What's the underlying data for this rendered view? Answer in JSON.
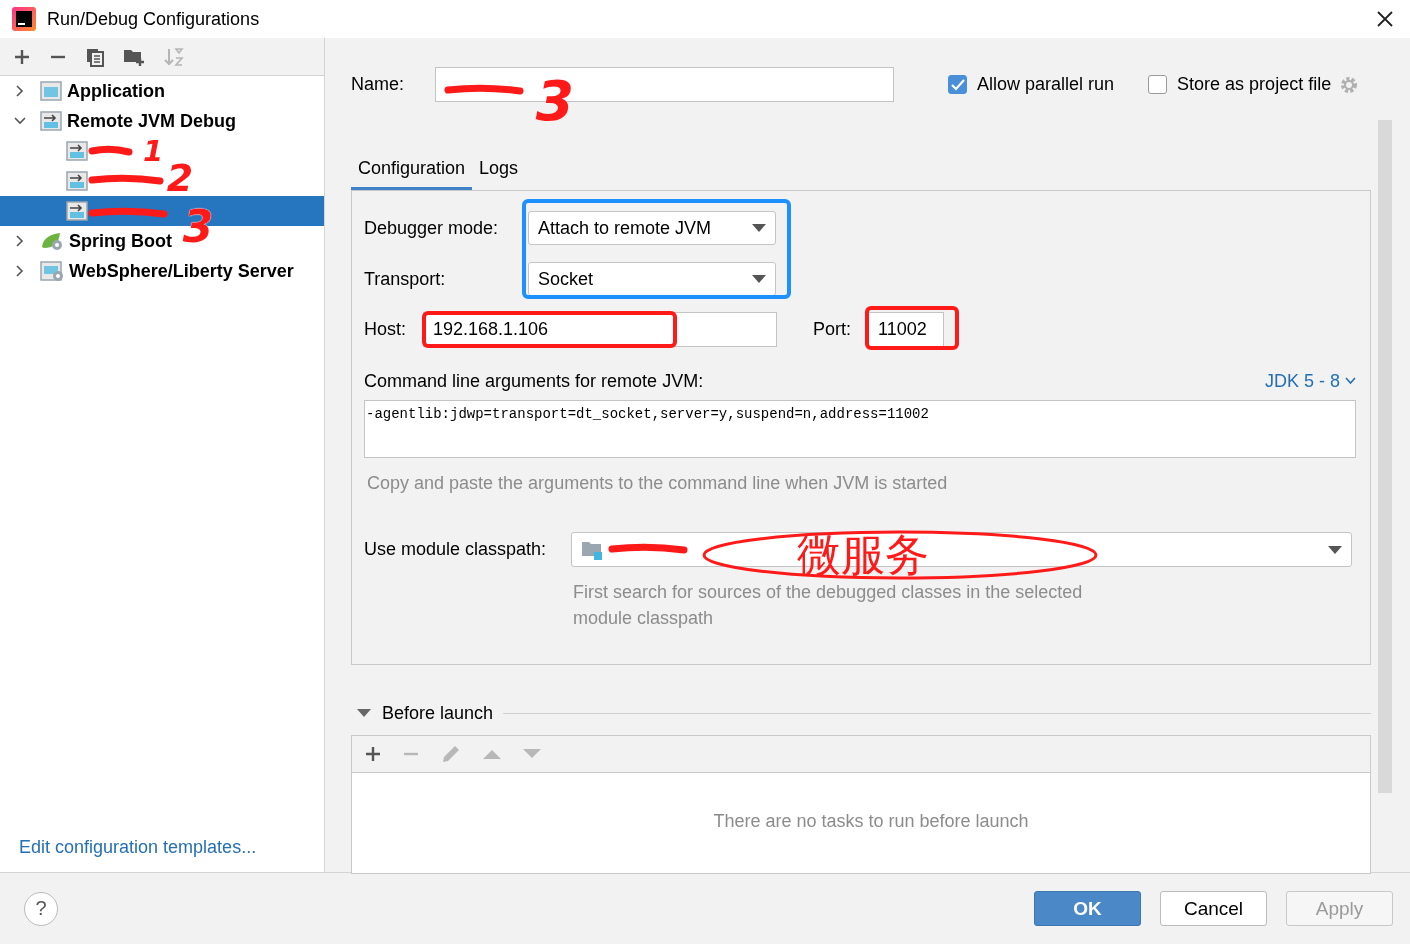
{
  "window": {
    "title": "Run/Debug Configurations"
  },
  "sidebar": {
    "toolbar": [
      {
        "kind": "add",
        "disabled": false
      },
      {
        "kind": "remove",
        "disabled": false
      },
      {
        "kind": "copy",
        "disabled": false
      },
      {
        "kind": "folder",
        "disabled": false
      },
      {
        "kind": "sort",
        "disabled": true
      }
    ],
    "tree": [
      {
        "label": "Application",
        "kind": "application",
        "expanded": false,
        "selected": false
      },
      {
        "label": "Remote JVM Debug",
        "kind": "remote",
        "expanded": true,
        "selected": false,
        "children": [
          {
            "kind": "remote",
            "selected": false
          },
          {
            "kind": "remote",
            "selected": false
          },
          {
            "kind": "remote",
            "selected": true
          }
        ]
      },
      {
        "label": "Spring Boot",
        "kind": "spring",
        "expanded": false,
        "selected": false
      },
      {
        "label": "WebSphere/Liberty Server",
        "kind": "websphere",
        "expanded": false,
        "selected": false
      }
    ],
    "link": "Edit configuration templates..."
  },
  "name": {
    "label": "Name:"
  },
  "options": [
    {
      "label": "Allow parallel run",
      "checked": true
    },
    {
      "label": "Store as project file",
      "checked": false
    }
  ],
  "tabs": [
    {
      "label": "Configuration",
      "selected": true
    },
    {
      "label": "Logs",
      "selected": false
    }
  ],
  "configuration": {
    "debugger_mode": {
      "label": "Debugger mode:",
      "value": "Attach to remote JVM"
    },
    "transport": {
      "label": "Transport:",
      "value": "Socket"
    },
    "host": {
      "label": "Host:",
      "value": "192.168.1.106"
    },
    "port": {
      "label": "Port:",
      "value": "11002"
    },
    "command_line": {
      "label": "Command line arguments for remote JVM:",
      "jdk_link": "JDK 5 - 8",
      "value": "-agentlib:jdwp=transport=dt_socket,server=y,suspend=n,address=11002",
      "hint": "Copy and paste the arguments to the command line when JVM is started"
    },
    "module_classpath": {
      "label": "Use module classpath:",
      "hint": "First search for sources of the debugged classes in the selected module classpath"
    }
  },
  "before_launch": {
    "title": "Before launch",
    "expanded": true,
    "toolbar": [
      {
        "kind": "add",
        "disabled": false
      },
      {
        "kind": "remove",
        "disabled": true
      },
      {
        "kind": "edit",
        "disabled": true
      },
      {
        "kind": "up",
        "disabled": true
      },
      {
        "kind": "down",
        "disabled": true
      }
    ],
    "empty_text": "There are no tasks to run before launch"
  },
  "footer": {
    "help": "?",
    "buttons": [
      {
        "label": "OK",
        "kind": "primary",
        "disabled": false
      },
      {
        "label": "Cancel",
        "kind": "normal",
        "disabled": false
      },
      {
        "label": "Apply",
        "kind": "normal",
        "disabled": true
      }
    ]
  },
  "annotations": [
    {
      "kind": "scribble"
    },
    {
      "kind": "digit",
      "text": "3"
    },
    {
      "kind": "scribble"
    },
    {
      "kind": "digit",
      "text": "1"
    },
    {
      "kind": "scribble"
    },
    {
      "kind": "digit",
      "text": "2"
    },
    {
      "kind": "scribble"
    },
    {
      "kind": "digit",
      "text": "3"
    },
    {
      "kind": "box",
      "color": "#1e90ff"
    },
    {
      "kind": "box",
      "color": "#ff1a1a"
    },
    {
      "kind": "box",
      "color": "#ff1a1a"
    },
    {
      "kind": "scribble"
    },
    {
      "kind": "ellipse"
    },
    {
      "kind": "text",
      "text": "微服务"
    }
  ]
}
